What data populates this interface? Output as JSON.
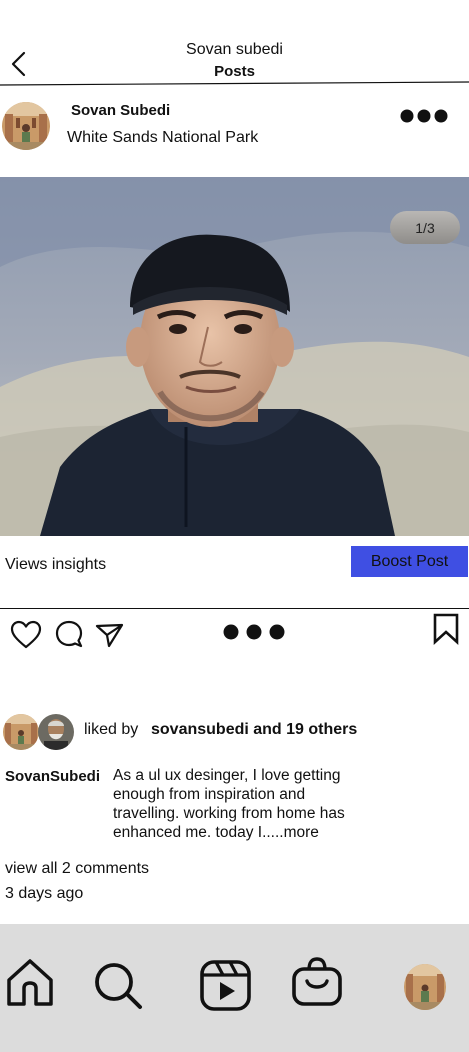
{
  "header": {
    "username": "Sovan subedi",
    "title": "Posts"
  },
  "post": {
    "author": "Sovan Subedi",
    "location": "White Sands National Park",
    "image_counter": "1/3",
    "views_insights": "Views insights",
    "boost_label": "Boost Post"
  },
  "likes": {
    "prefix": "liked by",
    "names": "sovansubedi and 19 others"
  },
  "caption": {
    "user": "SovanSubedi",
    "text_lines": [
      "As a ul ux desinger, I love getting",
      "enough from inspiration and",
      "travelling. working from home has",
      "enhanced me. today I.....more"
    ]
  },
  "comments": {
    "view_all": "view all 2 comments",
    "time_ago": "3 days ago"
  },
  "colors": {
    "boost_button": "#3f4fe3",
    "bottom_nav": "#dcdcdc"
  },
  "icons": {
    "back": "chevron-left-icon",
    "more": "more-dots-icon",
    "like": "heart-icon",
    "comment": "comment-icon",
    "share": "send-icon",
    "save": "bookmark-icon",
    "home": "home-icon",
    "search": "search-icon",
    "reels": "reels-icon",
    "shop": "shopping-bag-icon"
  }
}
